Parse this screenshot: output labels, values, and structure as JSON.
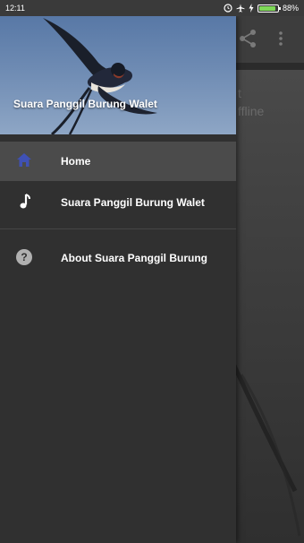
{
  "status_bar": {
    "time": "12:11",
    "battery": "88%",
    "battery_level": 0.88
  },
  "drawer": {
    "header_title": "Suara Panggil Burung Walet",
    "items": [
      {
        "label": "Home",
        "icon": "home-icon",
        "active": true
      },
      {
        "label": "Suara Panggil Burung Walet",
        "icon": "music-note-icon",
        "active": false
      },
      {
        "label": "About Suara Panggil Burung",
        "icon": "help-icon",
        "active": false
      }
    ]
  },
  "background": {
    "text_line1": "t",
    "text_line2": "ffline"
  },
  "colors": {
    "drawer_bg": "#303030",
    "active_bg": "#4b4b4b",
    "accent": "#3f51b5"
  }
}
